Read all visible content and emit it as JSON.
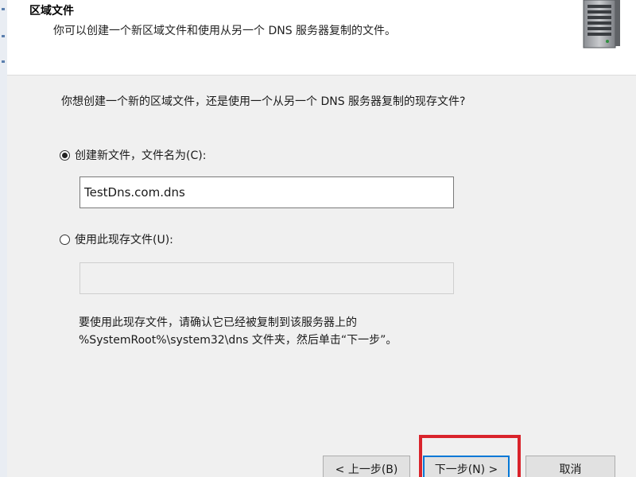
{
  "header": {
    "title": "区域文件",
    "subtitle": "你可以创建一个新区域文件和使用从另一个 DNS 服务器复制的文件。"
  },
  "body": {
    "question": "你想创建一个新的区域文件，还是使用一个从另一个 DNS 服务器复制的现存文件?",
    "option_new": {
      "label": "创建新文件，文件名为(C):",
      "selected": true,
      "value": "TestDns.com.dns"
    },
    "option_existing": {
      "label": "使用此现存文件(U):",
      "selected": false,
      "value": ""
    },
    "note_line1": "要使用此现存文件，请确认它已经被复制到该服务器上的",
    "note_line2": "%SystemRoot%\\system32\\dns 文件夹，然后单击“下一步”。"
  },
  "buttons": {
    "back": "< 上一步(B)",
    "next": "下一步(N) >",
    "cancel": "取消"
  },
  "colors": {
    "highlight": "#d9232b",
    "focus": "#0078d7"
  },
  "icons": {
    "header": "server-icon"
  }
}
